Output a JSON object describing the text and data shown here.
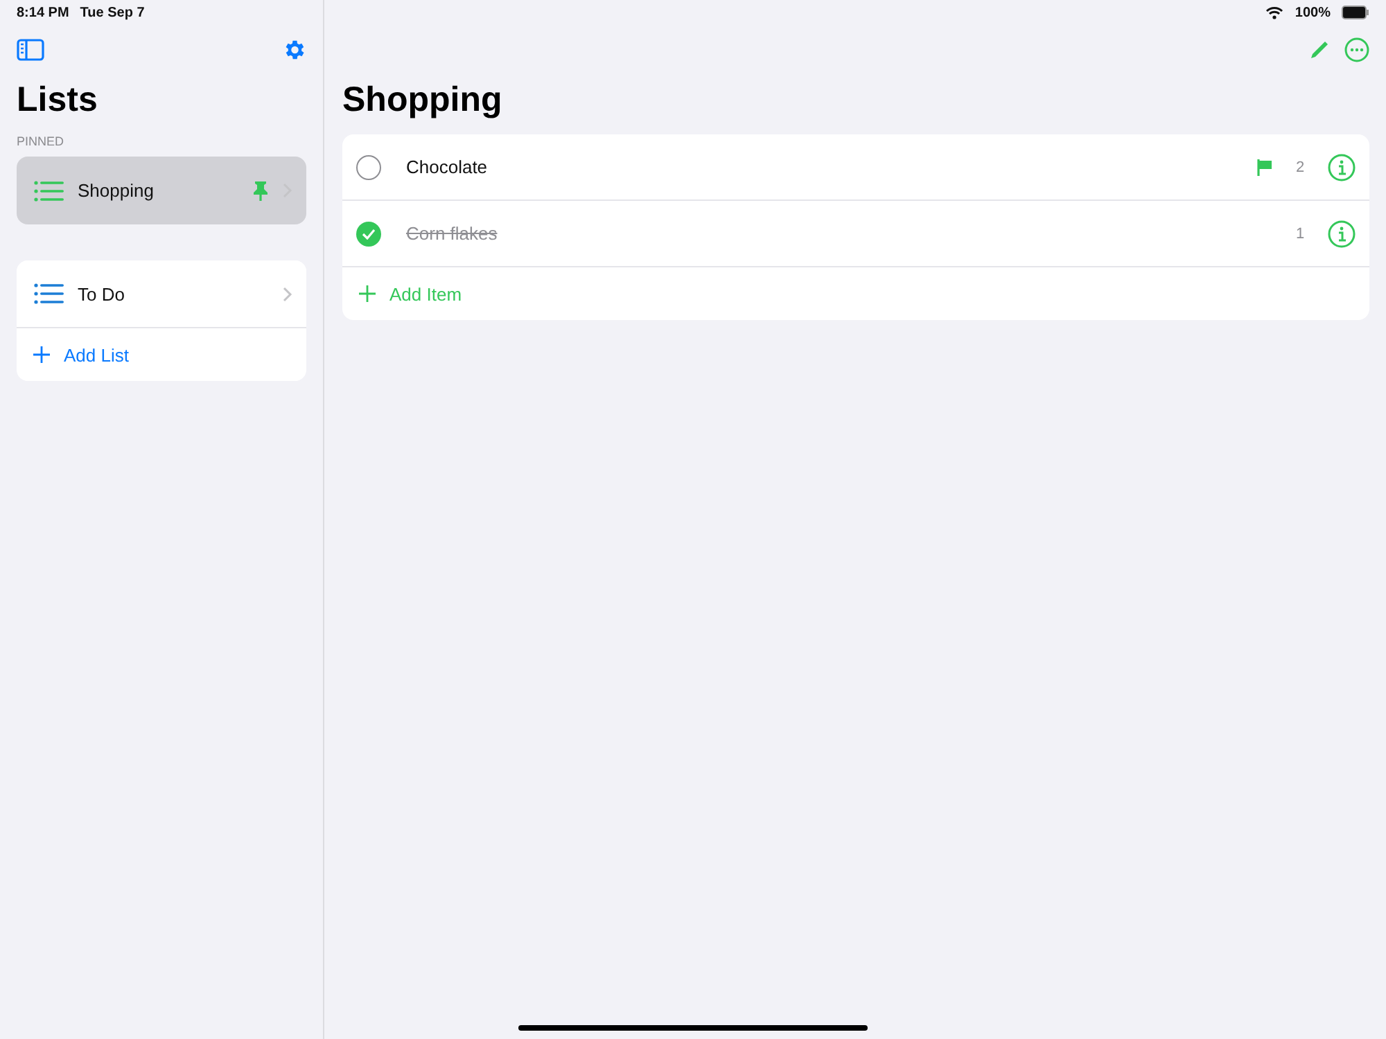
{
  "status_bar": {
    "time": "8:14 PM",
    "date": "Tue Sep 7",
    "battery": "100%"
  },
  "sidebar": {
    "title": "Lists",
    "pinned_header": "PINNED",
    "pinned": [
      {
        "name": "Shopping",
        "color": "#34c759",
        "selected": true,
        "pinned": true
      }
    ],
    "lists": [
      {
        "name": "To Do",
        "color": "#1c7ed6",
        "selected": false,
        "pinned": false
      }
    ],
    "add_label": "Add List"
  },
  "detail": {
    "title": "Shopping",
    "items": [
      {
        "name": "Chocolate",
        "checked": false,
        "flagged": true,
        "quantity": "2"
      },
      {
        "name": "Corn flakes",
        "checked": true,
        "flagged": false,
        "quantity": "1"
      }
    ],
    "add_label": "Add Item"
  }
}
